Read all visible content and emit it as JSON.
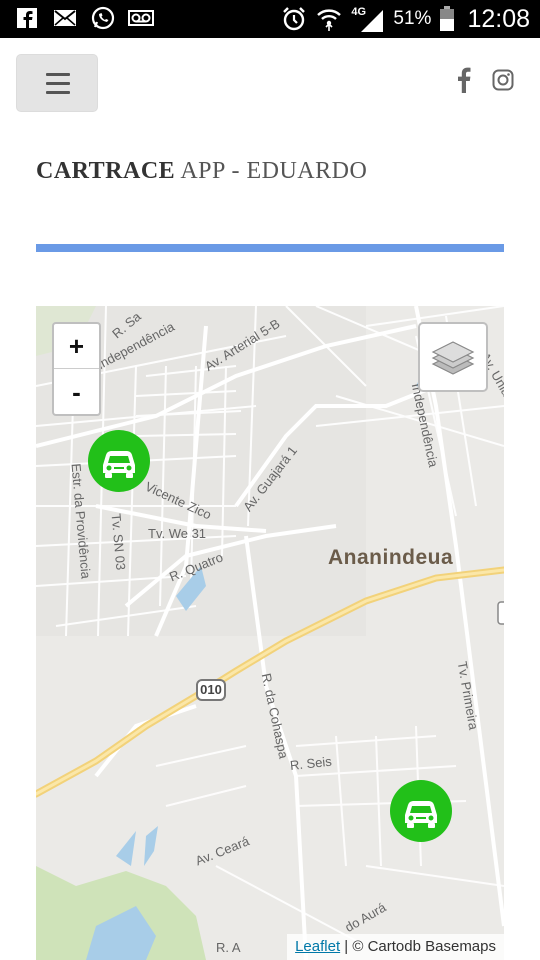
{
  "status_bar": {
    "network": "4G",
    "battery": "51%",
    "time": "12:08",
    "icons": [
      "facebook-icon",
      "email-icon",
      "whatsapp-icon",
      "voicemail-icon",
      "alarm-icon",
      "wifi-icon",
      "signal-icon",
      "battery-icon"
    ]
  },
  "header": {
    "menu_icon": "hamburger-icon",
    "social": [
      "facebook-icon",
      "instagram-icon"
    ]
  },
  "page": {
    "title_bold": "CARTRACE",
    "title_rest": " APP - EDUARDO",
    "accent_color": "#6a9ae6"
  },
  "map": {
    "zoom_in": "+",
    "zoom_out": "-",
    "layers_icon": "layers-icon",
    "city": "Ananindeua",
    "highway_shield": "010",
    "street_labels": [
      "R. Sa",
      "Independência",
      "Av. Arterial 5-B",
      "Estr. da Providência",
      "Tv. SN 03",
      "Vicente Zico",
      "Tv. We 31",
      "R. Quatro",
      "Av. Guajará 1",
      "Independência",
      "R. da Cohaspa",
      "R. Seis",
      "Av. Ceará",
      "Tv. Primeira",
      "do Aurá",
      "R. A",
      "Av. União"
    ],
    "markers": [
      {
        "name": "car-marker-1",
        "icon": "car-icon",
        "color": "#22c019"
      },
      {
        "name": "car-marker-2",
        "icon": "car-icon",
        "color": "#22c019"
      }
    ],
    "attribution": {
      "link": "Leaflet",
      "text": " | © Cartodb Basemaps"
    }
  }
}
